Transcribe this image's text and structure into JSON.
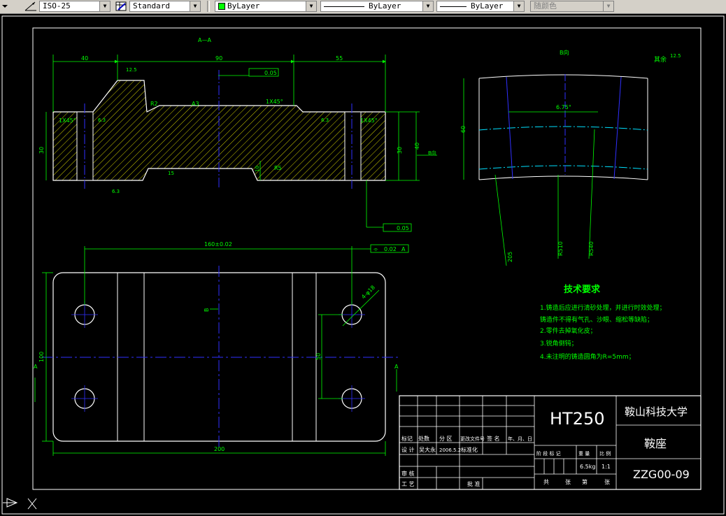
{
  "toolbar": {
    "dimstyle": "ISO-25",
    "tablestyle": "Standard",
    "layer_color": "ByLayer",
    "linetype": "ByLayer",
    "lineweight": "ByLayer",
    "plotstyle": "随颜色",
    "colors": {
      "layer_swatch": "#00ff00"
    }
  },
  "drawing": {
    "section_label": "A—A",
    "view_b_label": "B向",
    "view_b_arrow": "B向",
    "rest_roughness": "其余",
    "rest_roughness_value": "12.5",
    "dims": {
      "w40": "40",
      "w90": "90",
      "w55": "55",
      "r125": "12.5",
      "r2": "R2",
      "a3": "A3",
      "flat1": "0.05",
      "chamfer_left": "1X45°",
      "chamfer_mid": "1X45°",
      "chamfer_right": "1X45°",
      "rough_left": "6.3",
      "rough_right": "6.3",
      "h30_left": "30",
      "h30_right": "30",
      "h40": "40",
      "h10": "10",
      "r5": "R5",
      "rough_15": "15",
      "rough_bottom": "6.3",
      "flat2": "0.05",
      "angle": "6.75°",
      "h60": "60",
      "r205": "205",
      "r510": "R510",
      "r540": "R540",
      "w160": "160±0.02",
      "sym_tol": "0.02",
      "sym_ref": "A",
      "holes": "4-φ18",
      "w200": "200",
      "h100": "100",
      "h50": "50",
      "b_mark": "B",
      "a_left": "A",
      "a_right": "A"
    },
    "tech": {
      "title": "技术要求",
      "lines": [
        "1.铸造后应进行清砂处理，并进行时效处理；",
        "铸造件不得有气孔、沙眼、缩松等缺陷；",
        "2.零件去掉氧化皮；",
        "3.锐角倒钝；",
        "4.未注明的铸造圆角为R=5mm；"
      ]
    },
    "title_block": {
      "material": "HT250",
      "school": "鞍山科技大学",
      "part_name": "鞍座",
      "drawing_no": "ZZG00-09",
      "hdr_mark": "标记",
      "hdr_count": "处数",
      "hdr_zone": "分 区",
      "hdr_doc": "更改文件号",
      "hdr_sign": "签 名",
      "hdr_date": "年、月、日",
      "design": "设 计",
      "designer": "吴大永",
      "date": "2006.5.2",
      "std": "标准化",
      "review": "审 核",
      "process": "工 艺",
      "approve": "批 准",
      "stage": "阶 段 标 记",
      "weight": "重 量",
      "scale": "比 例",
      "weight_val": "6.5kg",
      "scale_val": "1:1",
      "total": "共",
      "sheets": "张",
      "page": "第",
      "sheet2": "张"
    }
  }
}
